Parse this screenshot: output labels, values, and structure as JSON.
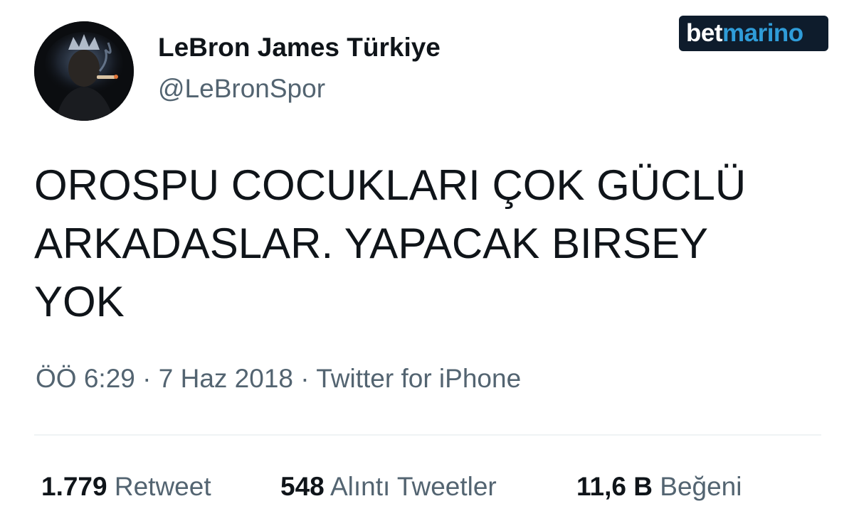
{
  "author": {
    "display_name": "LeBron James Türkiye",
    "handle": "@LeBronSpor",
    "avatar_icon": "profile-photo"
  },
  "brand": {
    "part1": "bet",
    "part2": "marino",
    "colors": {
      "background": "#0e1c2c",
      "part1": "#ffffff",
      "part2": "#2f9cd8"
    }
  },
  "tweet": {
    "lines": [
      "OROSPU COCUKLARI ÇOK GÜCLÜ",
      "ARKADASLAR. YAPACAK BIRSEY",
      "YOK"
    ]
  },
  "meta": {
    "time": "ÖÖ 6:29",
    "separator": "·",
    "date": "7 Haz 2018",
    "source": "Twitter for iPhone"
  },
  "stats": {
    "retweets": {
      "count": "1.779",
      "label": "Retweet"
    },
    "quotes": {
      "count": "548",
      "label": "Alıntı Tweetler"
    },
    "likes": {
      "count": "11,6 B",
      "label": "Beğeni"
    }
  },
  "colors": {
    "text_primary": "#0f1419",
    "text_secondary": "#536471",
    "divider": "#eff3f4"
  }
}
